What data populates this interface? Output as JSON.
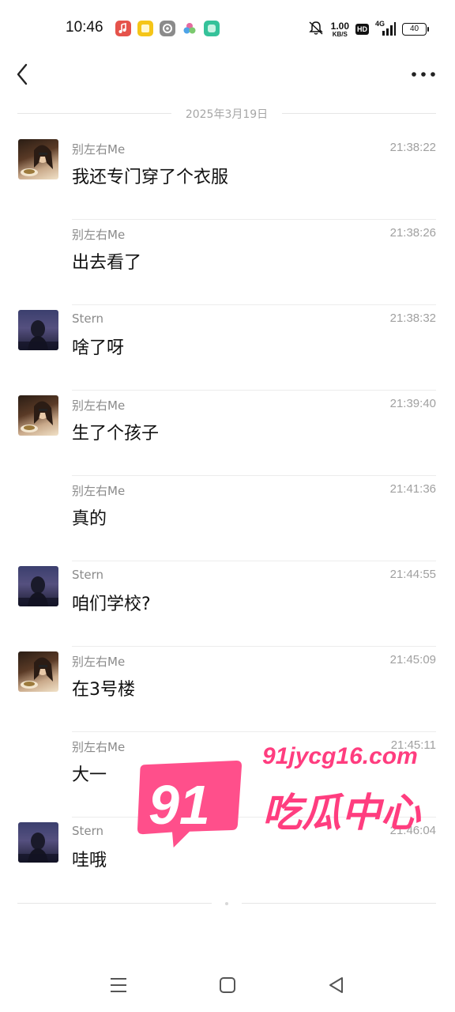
{
  "status_bar": {
    "time": "10:46",
    "net_speed_value": "1.00",
    "net_speed_unit": "KB/S",
    "hd": "HD",
    "network": "4G",
    "battery": "40",
    "app_icons": [
      "music-app-icon",
      "notes-app-icon",
      "settings-app-icon",
      "gallery-app-icon",
      "chat-app-icon"
    ]
  },
  "header": {
    "back_icon": "chevron-left-icon",
    "more_icon": "more-horizontal-icon"
  },
  "date_divider": "2025年3月19日",
  "messages": [
    {
      "sender": "别左右Me",
      "time": "21:38:22",
      "text": "我还专门穿了个衣服",
      "avatar": "a"
    },
    {
      "sender": "别左右Me",
      "time": "21:38:26",
      "text": "出去看了",
      "avatar": ""
    },
    {
      "sender": "Stern",
      "time": "21:38:32",
      "text": "啥了呀",
      "avatar": "b"
    },
    {
      "sender": "别左右Me",
      "time": "21:39:40",
      "text": "生了个孩子",
      "avatar": "a"
    },
    {
      "sender": "别左右Me",
      "time": "21:41:36",
      "text": "真的",
      "avatar": ""
    },
    {
      "sender": "Stern",
      "time": "21:44:55",
      "text": "咱们学校?",
      "avatar": "b"
    },
    {
      "sender": "别左右Me",
      "time": "21:45:09",
      "text": "在3号楼",
      "avatar": "a"
    },
    {
      "sender": "别左右Me",
      "time": "21:45:11",
      "text": "大一",
      "avatar": ""
    },
    {
      "sender": "Stern",
      "time": "21:46:04",
      "text": "哇哦",
      "avatar": "b"
    }
  ],
  "watermark": {
    "number": "91",
    "site": "91jycg16.com",
    "title": "吃瓜中心"
  },
  "nav_bar": {
    "icons": [
      "menu-icon",
      "home-icon",
      "back-triangle-icon"
    ]
  },
  "colors": {
    "watermark_pink": "#ff3d7f",
    "separator": "#ececec",
    "secondary_text": "#8a8a8a"
  }
}
